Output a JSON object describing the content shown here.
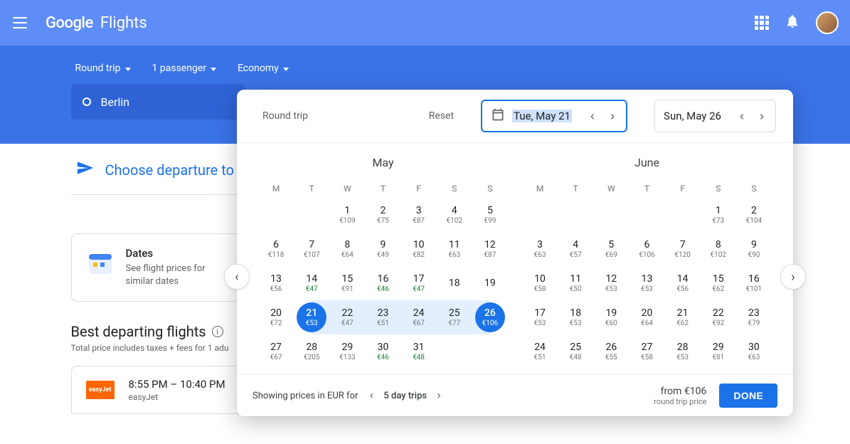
{
  "header": {
    "brand_google": "Google",
    "brand_flights": "Flights"
  },
  "search": {
    "trip_type": "Round trip",
    "passengers": "1 passenger",
    "cabin": "Economy",
    "origin": "Berlin"
  },
  "below": {
    "choose_departure": "Choose departure to",
    "dates_card": {
      "title": "Dates",
      "subtitle": "See flight prices for similar dates"
    },
    "best_heading": "Best departing flights",
    "best_sub": "Total price includes taxes + fees for 1 adu",
    "flight": {
      "airline_logo": "easyJet",
      "times": "8:55 PM – 10:40 PM",
      "airline": "easyJet"
    }
  },
  "picker": {
    "trip_label": "Round trip",
    "reset": "Reset",
    "depart_date": "Tue, May 21",
    "return_date": "Sun, May 26",
    "weekdays": [
      "M",
      "T",
      "W",
      "T",
      "F",
      "S",
      "S"
    ],
    "months": [
      {
        "name": "May",
        "leading_blanks": 2,
        "days": [
          {
            "d": "1",
            "p": "€109"
          },
          {
            "d": "2",
            "p": "€75"
          },
          {
            "d": "3",
            "p": "€87"
          },
          {
            "d": "4",
            "p": "€102"
          },
          {
            "d": "5",
            "p": "€99"
          },
          {
            "d": "6",
            "p": "€118"
          },
          {
            "d": "7",
            "p": "€107"
          },
          {
            "d": "8",
            "p": "€64"
          },
          {
            "d": "9",
            "p": "€49"
          },
          {
            "d": "10",
            "p": "€82"
          },
          {
            "d": "11",
            "p": "€63"
          },
          {
            "d": "12",
            "p": "€87"
          },
          {
            "d": "13",
            "p": "€56"
          },
          {
            "d": "14",
            "p": "€47",
            "g": true
          },
          {
            "d": "15",
            "p": "€91"
          },
          {
            "d": "16",
            "p": "€46",
            "g": true
          },
          {
            "d": "17",
            "p": "€47",
            "g": true
          },
          {
            "d": "18",
            "p": ""
          },
          {
            "d": "19",
            "p": ""
          },
          {
            "d": "20",
            "p": "€72"
          },
          {
            "d": "21",
            "p": "€53",
            "start": true
          },
          {
            "d": "22",
            "p": "€47",
            "range": true
          },
          {
            "d": "23",
            "p": "€51",
            "range": true
          },
          {
            "d": "24",
            "p": "€67",
            "range": true
          },
          {
            "d": "25",
            "p": "€77",
            "range": true
          },
          {
            "d": "26",
            "p": "€106",
            "end": true
          },
          {
            "d": "27",
            "p": "€67"
          },
          {
            "d": "28",
            "p": "€205"
          },
          {
            "d": "29",
            "p": "€133"
          },
          {
            "d": "30",
            "p": "€46",
            "g": true
          },
          {
            "d": "31",
            "p": "€48",
            "g": true
          }
        ]
      },
      {
        "name": "June",
        "leading_blanks": 5,
        "days": [
          {
            "d": "1",
            "p": "€73"
          },
          {
            "d": "2",
            "p": "€104"
          },
          {
            "d": "3",
            "p": "€63"
          },
          {
            "d": "4",
            "p": "€57"
          },
          {
            "d": "5",
            "p": "€69"
          },
          {
            "d": "6",
            "p": "€106"
          },
          {
            "d": "7",
            "p": "€120"
          },
          {
            "d": "8",
            "p": "€102"
          },
          {
            "d": "9",
            "p": "€90"
          },
          {
            "d": "10",
            "p": "€58"
          },
          {
            "d": "11",
            "p": "€50"
          },
          {
            "d": "12",
            "p": "€53"
          },
          {
            "d": "13",
            "p": "€53"
          },
          {
            "d": "14",
            "p": "€56"
          },
          {
            "d": "15",
            "p": "€62"
          },
          {
            "d": "16",
            "p": "€101"
          },
          {
            "d": "17",
            "p": "€53"
          },
          {
            "d": "18",
            "p": "€53"
          },
          {
            "d": "19",
            "p": "€60"
          },
          {
            "d": "20",
            "p": "€64"
          },
          {
            "d": "21",
            "p": "€62"
          },
          {
            "d": "22",
            "p": "€92"
          },
          {
            "d": "23",
            "p": "€79"
          },
          {
            "d": "24",
            "p": "€51"
          },
          {
            "d": "25",
            "p": "€48"
          },
          {
            "d": "26",
            "p": "€55"
          },
          {
            "d": "27",
            "p": "€58"
          },
          {
            "d": "28",
            "p": "€53"
          },
          {
            "d": "29",
            "p": "€81"
          },
          {
            "d": "30",
            "p": "€63"
          }
        ]
      }
    ],
    "footer": {
      "prices_label": "Showing prices in EUR for",
      "trip_length": "5 day trips",
      "from_label": "from €106",
      "price_label": "round trip price",
      "done": "DONE"
    }
  }
}
